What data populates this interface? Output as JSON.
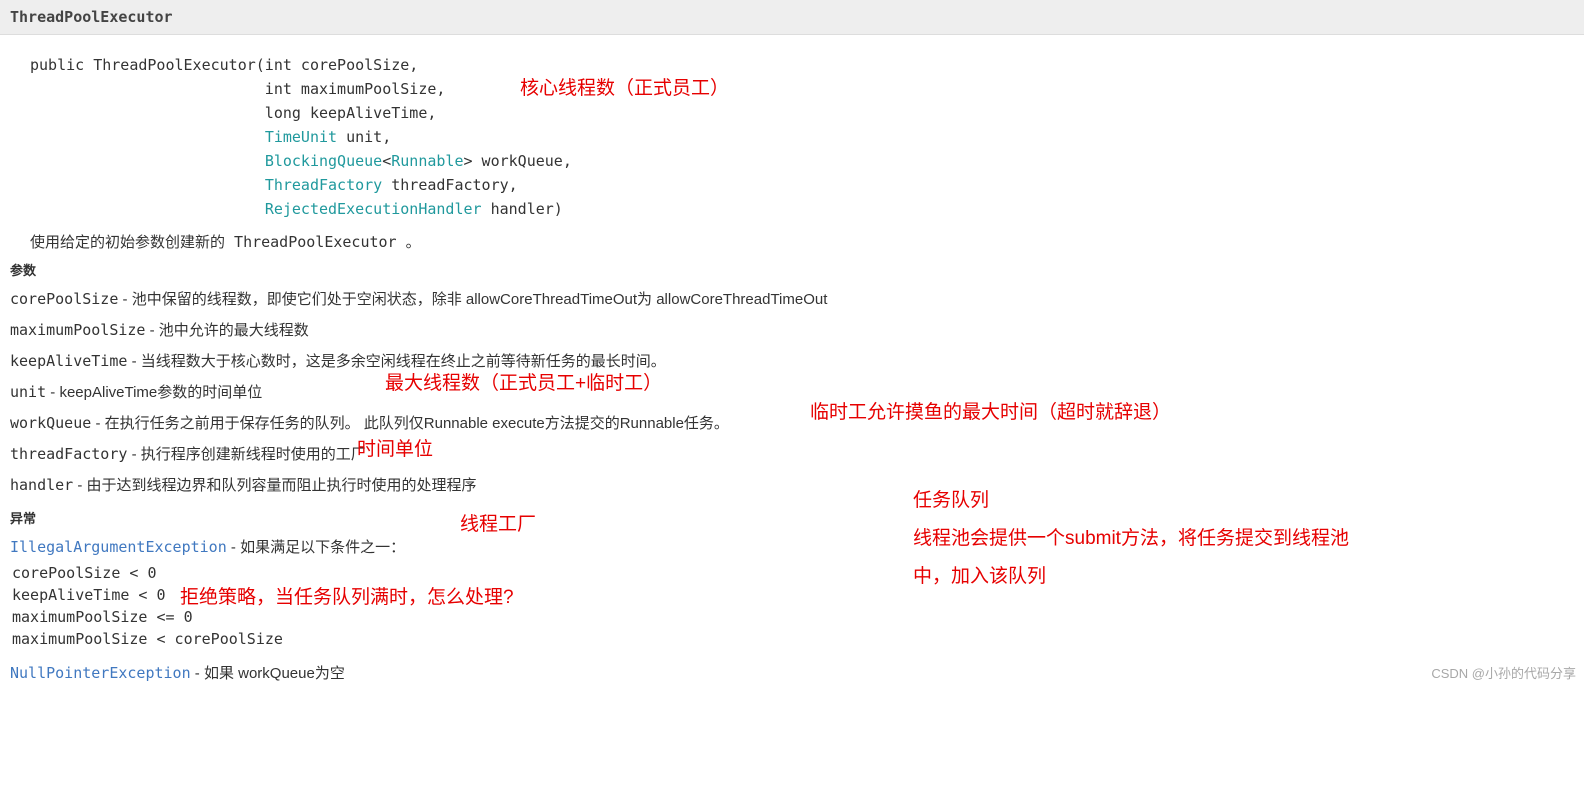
{
  "header": {
    "title": "ThreadPoolExecutor"
  },
  "code": {
    "line1_pre": "public ThreadPoolExecutor(int corePoolSize,",
    "line2": "                          int maximumPoolSize,",
    "line3": "                          long keepAliveTime,",
    "line4_pre": "                          ",
    "line4_type": "TimeUnit",
    "line4_post": " unit,",
    "line5_pre": "                          ",
    "line5_type1": "BlockingQueue",
    "line5_lt": "<",
    "line5_type2": "Runnable",
    "line5_gt": "> workQueue,",
    "line6_pre": "                          ",
    "line6_type": "ThreadFactory",
    "line6_post": " threadFactory,",
    "line7_pre": "                          ",
    "line7_type": "RejectedExecutionHandler",
    "line7_post": " handler)"
  },
  "desc": {
    "text": "使用给定的初始参数创建新的 ThreadPoolExecutor 。"
  },
  "sections": {
    "params": "参数",
    "exceptions": "异常"
  },
  "params": {
    "p1_name": "corePoolSize",
    "p1_desc": " - 池中保留的线程数，即使它们处于空闲状态，除非 allowCoreThreadTimeOut为 allowCoreThreadTimeOut",
    "p2_name": "maximumPoolSize",
    "p2_desc": " - 池中允许的最大线程数",
    "p3_name": "keepAliveTime",
    "p3_desc": " - 当线程数大于核心数时，这是多余空闲线程在终止之前等待新任务的最长时间。",
    "p4_name": "unit",
    "p4_desc": " - keepAliveTime参数的时间单位",
    "p5_name": "workQueue",
    "p5_desc": " - 在执行任务之前用于保存任务的队列。 此队列仅Runnable execute方法提交的Runnable任务。",
    "p6_name": "threadFactory",
    "p6_desc": " - 执行程序创建新线程时使用的工厂",
    "p7_name": "handler",
    "p7_desc": " - 由于达到线程边界和队列容量而阻止执行时使用的处理程序"
  },
  "exceptions": {
    "e1_name": "IllegalArgumentException",
    "e1_desc": " - 如果满足以下条件之一：",
    "c1": "corePoolSize < 0",
    "c2": "keepAliveTime < 0",
    "c3": "maximumPoolSize <= 0",
    "c4": "maximumPoolSize < corePoolSize",
    "e2_name": "NullPointerException",
    "e2_desc": " - 如果 workQueue为空"
  },
  "annots": {
    "a1": "核心线程数（正式员工）",
    "a2": "最大线程数（正式员工+临时工）",
    "a3": "临时工允许摸鱼的最大时间（超时就辞退）",
    "a4": "时间单位",
    "a5": "线程工厂",
    "a6_l1": "任务队列",
    "a6_l2": "线程池会提供一个submit方法，将任务提交到线程池",
    "a6_l3": "中，加入该队列",
    "a7": "拒绝策略，当任务队列满时，怎么处理?"
  },
  "watermark": {
    "text": "CSDN @小孙的代码分享"
  }
}
